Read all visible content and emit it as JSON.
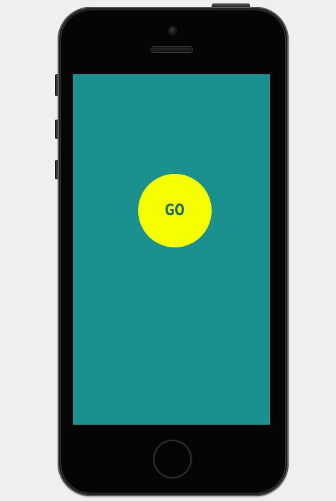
{
  "device": {
    "type": "phone",
    "screen_color": "#1b918f",
    "body_color": "#050505"
  },
  "app": {
    "go_button": {
      "label": "GO",
      "color": "#f5ff00",
      "text_color": "#1c6e66"
    }
  },
  "icons": {
    "camera": "front-camera-icon",
    "speaker": "earpiece-speaker-icon",
    "home": "home-button-icon"
  }
}
